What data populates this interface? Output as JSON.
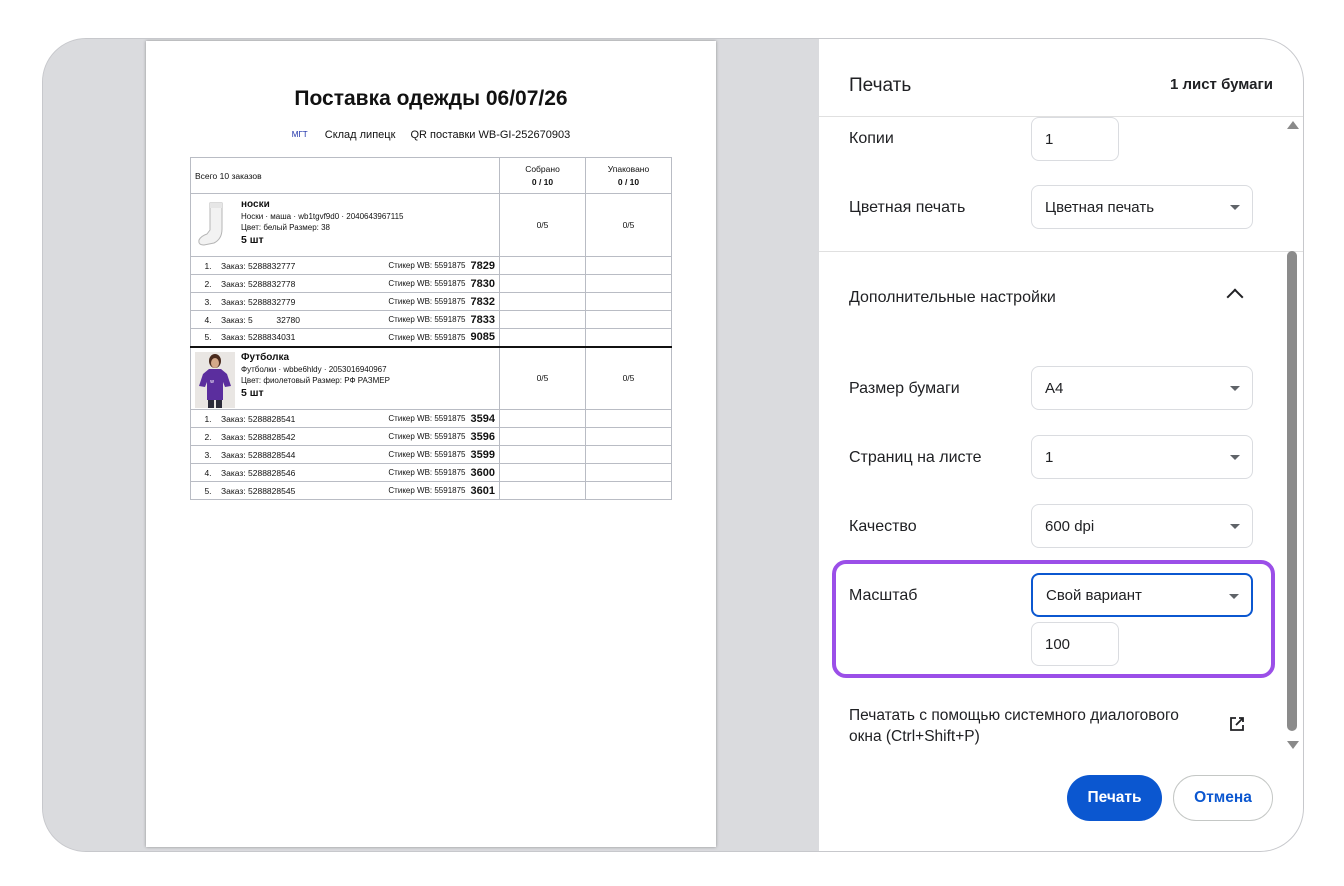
{
  "document": {
    "title": "Поставка одежды 06/07/26",
    "brand_tag": "МГТ",
    "warehouse": "Склад липецк",
    "qr_label": "QR поставки",
    "qr_code": "WB-GI-252670903",
    "table_header": {
      "total": "Всего 10 заказов",
      "collected_label": "Собрано",
      "collected_value": "0 / 10",
      "packed_label": "Упаковано",
      "packed_value": "0 / 10"
    },
    "products": [
      {
        "name": "носки",
        "line1": "Носки · маша · wb1tgvf9d0 · 2040643967115",
        "line2": "Цвет: белый Размер: 38",
        "qty": "5 шт",
        "collected": "0/5",
        "packed": "0/5",
        "image": "sock-icon",
        "orders": [
          {
            "n": "1.",
            "order": "Заказ: 5288832777",
            "sticker": "Стикер WB: 5591875",
            "last4": "7829"
          },
          {
            "n": "2.",
            "order": "Заказ: 5288832778",
            "sticker": "Стикер WB: 5591875",
            "last4": "7830"
          },
          {
            "n": "3.",
            "order": "Заказ: 5288832779",
            "sticker": "Стикер WB: 5591875",
            "last4": "7832"
          },
          {
            "n": "4.",
            "order": "Заказ: 5          32780",
            "sticker": "Стикер WB: 5591875",
            "last4": "7833"
          },
          {
            "n": "5.",
            "order": "Заказ: 5288834031",
            "sticker": "Стикер WB: 5591875",
            "last4": "9085"
          }
        ]
      },
      {
        "name": "Футболка",
        "line1": "Футболки · wbbe6hldy · 2053016940967",
        "line2": "Цвет: фиолетовый Размер: РФ РАЗМЕР",
        "qty": "5 шт",
        "collected": "0/5",
        "packed": "0/5",
        "image": "tshirt-photo",
        "orders": [
          {
            "n": "1.",
            "order": "Заказ: 5288828541",
            "sticker": "Стикер WB: 5591875",
            "last4": "3594"
          },
          {
            "n": "2.",
            "order": "Заказ: 5288828542",
            "sticker": "Стикер WB: 5591875",
            "last4": "3596"
          },
          {
            "n": "3.",
            "order": "Заказ: 5288828544",
            "sticker": "Стикер WB: 5591875",
            "last4": "3599"
          },
          {
            "n": "4.",
            "order": "Заказ: 5288828546",
            "sticker": "Стикер WB: 5591875",
            "last4": "3600"
          },
          {
            "n": "5.",
            "order": "Заказ: 5288828545",
            "sticker": "Стикер WB: 5591875",
            "last4": "3601"
          }
        ]
      }
    ]
  },
  "print_panel": {
    "title": "Печать",
    "sheets": "1 лист бумаги",
    "copies_label": "Копии",
    "copies_value": "1",
    "color_label": "Цветная печать",
    "color_value": "Цветная печать",
    "advanced_label": "Дополнительные настройки",
    "paper_label": "Размер бумаги",
    "paper_value": "A4",
    "pages_per_sheet_label": "Страниц на листе",
    "pages_per_sheet_value": "1",
    "quality_label": "Качество",
    "quality_value": "600 dpi",
    "scale_label": "Масштаб",
    "scale_value": "Свой вариант",
    "scale_custom": "100",
    "system_dialog": "Печатать с помощью системного диалогового окна (Ctrl+Shift+P)",
    "print_button": "Печать",
    "cancel_button": "Отмена",
    "accent_color": "#0b57d0",
    "highlight_color": "#9b4fe8"
  }
}
